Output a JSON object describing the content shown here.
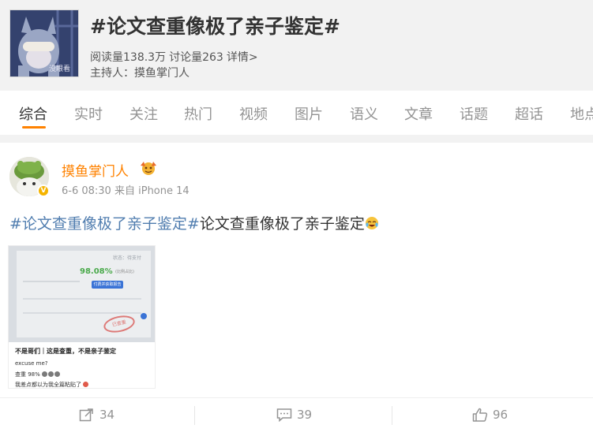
{
  "topic": {
    "title": "#论文查重像极了亲子鉴定#",
    "reads": "阅读量138.3万",
    "discussions": "讨论量263",
    "details_link": "详情>",
    "host": "主持人：摸鱼掌门人",
    "avatar_caption": "没眼看"
  },
  "tabs": [
    "综合",
    "实时",
    "关注",
    "热门",
    "视频",
    "图片",
    "语义",
    "文章",
    "话题",
    "超话",
    "地点"
  ],
  "active_tab": "综合",
  "post": {
    "author": "摸鱼掌门人",
    "verified_badge": "V",
    "time": "6-6 08:30",
    "source": "来自 iPhone 14",
    "hashtag": "#论文查重像极了亲子鉴定#",
    "text": "论文查重像极了亲子鉴定",
    "image": {
      "percent": "98.08%",
      "percent_sub": "(比例占比)",
      "status_label": "状态：待支付",
      "button_label": "付费并获取报告",
      "stamp": "已查重",
      "caption_title": "不是哥们｜这是查重，不是亲子鉴定",
      "caption_lines": [
        "excuse me?",
        "查重 98%",
        "我差点都以为我全篇粘贴了"
      ]
    },
    "actions": {
      "forward": "34",
      "comment": "39",
      "like": "96"
    }
  },
  "colors": {
    "accent": "#ff8200",
    "link": "#507daf",
    "muted": "#939393"
  }
}
